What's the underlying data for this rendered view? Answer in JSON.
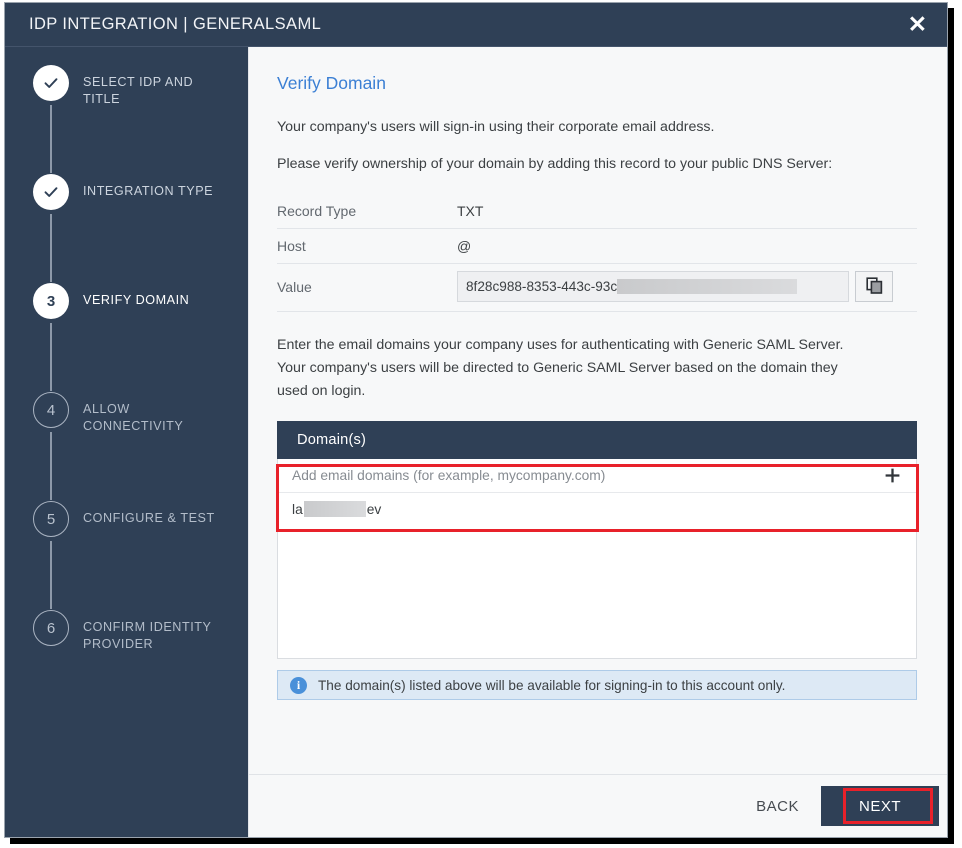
{
  "window": {
    "title": "IDP INTEGRATION | GENERALSAML",
    "close_label": "✕"
  },
  "colors": {
    "navy": "#2f4056",
    "link_blue": "#3b7fd4",
    "annotation_red": "#e8212a",
    "info_bg": "#dde9f5",
    "info_icon": "#4a90d9"
  },
  "sidebar": {
    "steps": [
      {
        "number": "1",
        "label": "SELECT IDP AND TITLE",
        "state": "done"
      },
      {
        "number": "2",
        "label": "INTEGRATION TYPE",
        "state": "done"
      },
      {
        "number": "3",
        "label": "VERIFY DOMAIN",
        "state": "current"
      },
      {
        "number": "4",
        "label": "ALLOW CONNECTIVITY",
        "state": "todo"
      },
      {
        "number": "5",
        "label": "CONFIGURE & TEST",
        "state": "todo"
      },
      {
        "number": "6",
        "label": "CONFIRM IDENTITY PROVIDER",
        "state": "todo"
      }
    ]
  },
  "main": {
    "title": "Verify Domain",
    "intro": "Your company's users will sign-in using their corporate email address.",
    "instruction": "Please verify ownership of your domain by adding this record to your public DNS Server:",
    "record": {
      "rows": [
        {
          "label": "Record Type",
          "value": "TXT"
        },
        {
          "label": "Host",
          "value": "@"
        }
      ],
      "value_label": "Value",
      "value_text": "8f28c988-8353-443c-93c",
      "copy_icon": "copy-icon"
    },
    "domains_intro_line1": "Enter the email domains your company uses for authenticating with Generic SAML Server.",
    "domains_intro_line2": "Your company's users will be directed to Generic SAML Server based on the domain they",
    "domains_intro_line3": "used on login.",
    "domains_panel": {
      "header": "Domain(s)",
      "input_placeholder": "Add email domains (for example, mycompany.com)",
      "input_value": "",
      "add_icon": "plus-icon",
      "items": [
        {
          "prefix": "la",
          "suffix": "ev"
        }
      ]
    },
    "info": {
      "icon": "info-icon",
      "glyph": "i",
      "text": "The domain(s) listed above will be available for signing-in to this account only."
    }
  },
  "footer": {
    "back_label": "BACK",
    "next_label": "NEXT"
  }
}
